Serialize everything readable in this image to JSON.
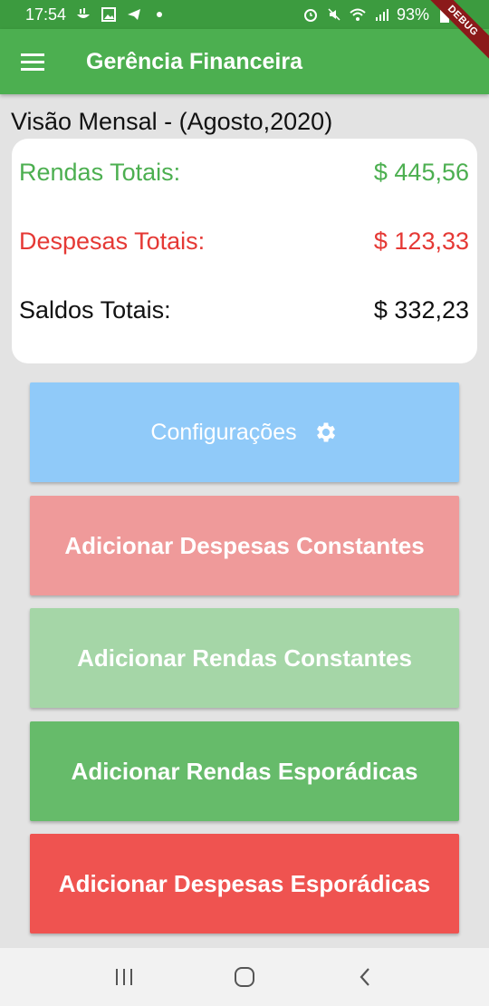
{
  "status_bar": {
    "time": "17:54",
    "battery": "93%",
    "left_icons": [
      "food-icon",
      "gallery-icon",
      "telegram-icon",
      "dot-icon"
    ],
    "right_icons": [
      "alarm-icon",
      "mute-icon",
      "wifi-icon",
      "signal-icon",
      "battery-icon"
    ]
  },
  "app_bar": {
    "title": "Gerência Financeira",
    "debug_label": "DEBUG"
  },
  "overview": {
    "title": "Visão Mensal - (Agosto,2020)",
    "income_label": "Rendas Totais:",
    "income_value": "$ 445,56",
    "expense_label": "Despesas Totais:",
    "expense_value": "$ 123,33",
    "balance_label": "Saldos Totais:",
    "balance_value": "$ 332,23"
  },
  "actions": {
    "config": "Configurações",
    "add_constant_expenses": "Adicionar Despesas Constantes",
    "add_constant_income": "Adicionar Rendas Constantes",
    "add_sporadic_income": "Adicionar Rendas Esporádicas",
    "add_sporadic_expenses": "Adicionar Despesas Esporádicas"
  },
  "colors": {
    "primary": "#4caf50",
    "status_bar": "#3c9b3f",
    "income": "#4caf50",
    "expense": "#e53935",
    "config_button": "#90caf9",
    "constant_expense_button": "#ef9a9a",
    "constant_income_button": "#a5d6a7",
    "sporadic_income_button": "#66bb6a",
    "sporadic_expense_button": "#ef5350"
  }
}
